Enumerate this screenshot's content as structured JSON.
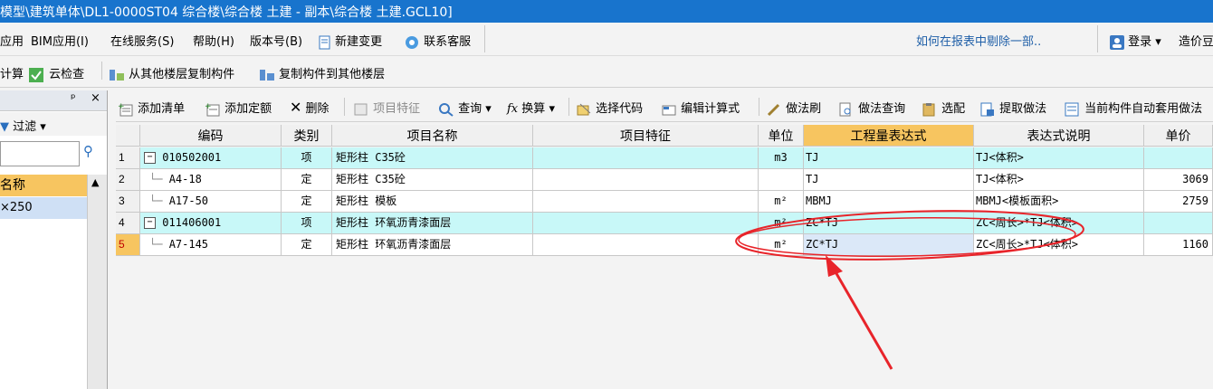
{
  "titlebar": {
    "title": "模型\\建筑单体\\DL1-0000ST04 综合楼\\综合楼 土建 - 副本\\综合楼 土建.GCL10]"
  },
  "menubar": {
    "items": [
      "应用",
      "BIM应用(I)",
      "在线服务(S)",
      "帮助(H)",
      "版本号(B)",
      "新建变更",
      "联系客服"
    ],
    "help_link": "如何在报表中剔除一部..",
    "login": "登录",
    "cost": "造价豆"
  },
  "toolbar2": {
    "calc": "计算",
    "cloud_check": "云检查",
    "copy_from": "从其他楼层复制构件",
    "copy_to": "复制构件到其他楼层"
  },
  "left_panel": {
    "pin": "ᵖ",
    "close": "×",
    "filter": "过滤",
    "col_header": "名称",
    "item": "×250"
  },
  "grid_toolbar": {
    "add_list": "添加清单",
    "add_quota": "添加定额",
    "delete": "删除",
    "item_feature": "项目特征",
    "query": "查询",
    "convert": "换算",
    "select_code": "选择代码",
    "edit_formula": "编辑计算式",
    "method_brush": "做法刷",
    "method_query": "做法查询",
    "select_match": "选配",
    "extract_method": "提取做法",
    "auto_apply": "当前构件自动套用做法"
  },
  "grid": {
    "columns": [
      "编码",
      "类别",
      "项目名称",
      "项目特征",
      "单位",
      "工程量表达式",
      "表达式说明",
      "单价"
    ],
    "rows": [
      {
        "num": "1",
        "code": "010502001",
        "type": "项",
        "name": "矩形柱  C35砼",
        "feature": "",
        "unit": "m3",
        "expr": "TJ",
        "desc": "TJ<体积>",
        "price": ""
      },
      {
        "num": "2",
        "code": "A4-18",
        "type": "定",
        "name": "矩形柱  C35砼",
        "feature": "",
        "unit": "",
        "expr": "TJ",
        "desc": "TJ<体积>",
        "price": "3069"
      },
      {
        "num": "3",
        "code": "A17-50",
        "type": "定",
        "name": "矩形柱  模板",
        "feature": "",
        "unit": "m²",
        "expr": "MBMJ",
        "desc": "MBMJ<模板面积>",
        "price": "2759"
      },
      {
        "num": "4",
        "code": "011406001",
        "type": "项",
        "name": "矩形柱  环氧沥青漆面层",
        "feature": "",
        "unit": "m²",
        "expr": "ZC*TJ",
        "desc": "ZC<周长>*TJ<体积>",
        "price": ""
      },
      {
        "num": "5",
        "code": "A7-145",
        "type": "定",
        "name": "矩形柱  环氧沥青漆面层",
        "feature": "",
        "unit": "m²",
        "expr": "ZC*TJ",
        "desc": "ZC<周长>*TJ<体积>",
        "price": "1160"
      }
    ]
  },
  "colors": {
    "title_bg": "#1874cd",
    "header_highlight": "#f7c560",
    "row_cyan": "#c8f8f8",
    "annotation_red": "#e8242a"
  }
}
